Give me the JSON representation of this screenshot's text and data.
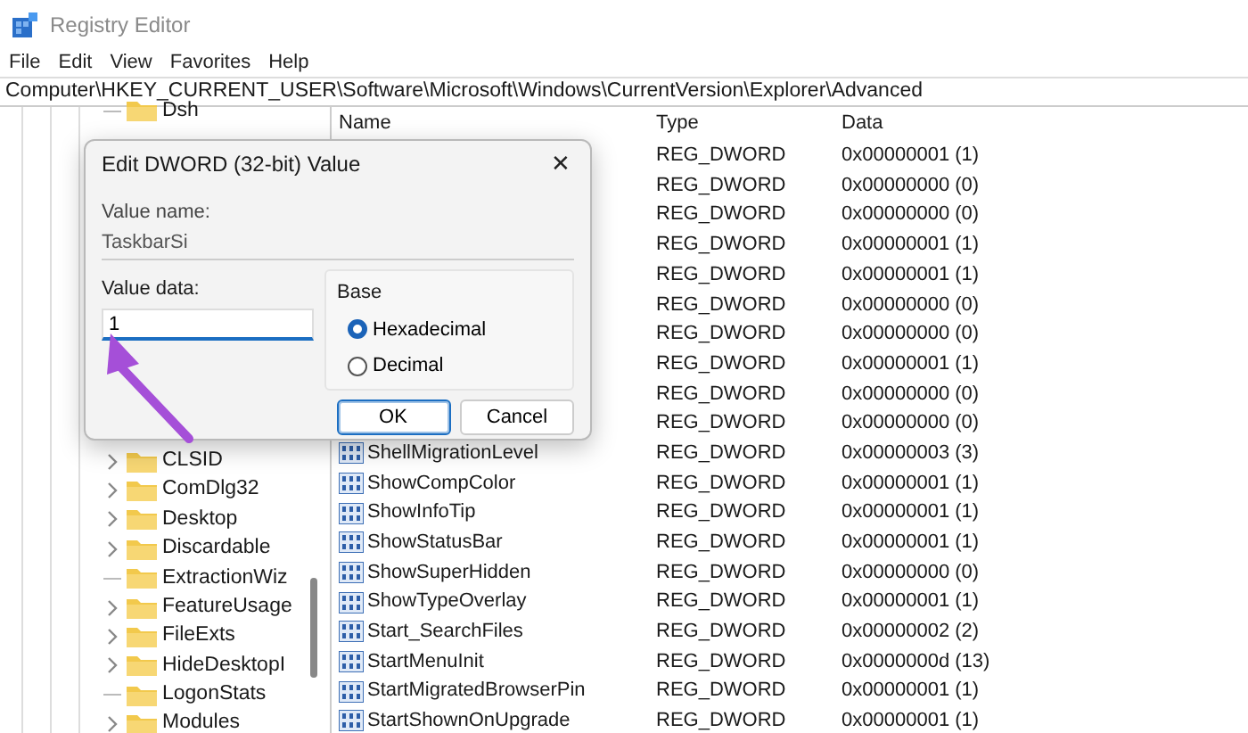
{
  "window": {
    "title": "Registry Editor"
  },
  "menu": [
    "File",
    "Edit",
    "View",
    "Favorites",
    "Help"
  ],
  "address": "Computer\\HKEY_CURRENT_USER\\Software\\Microsoft\\Windows\\CurrentVersion\\Explorer\\Advanced",
  "tree": {
    "items": [
      {
        "label": "Dsh",
        "expandable": false
      },
      {
        "label": "CLSID",
        "expandable": true
      },
      {
        "label": "ComDlg32",
        "expandable": true
      },
      {
        "label": "Desktop",
        "expandable": true
      },
      {
        "label": "Discardable",
        "expandable": true
      },
      {
        "label": "ExtractionWiz",
        "expandable": false
      },
      {
        "label": "FeatureUsage",
        "expandable": true
      },
      {
        "label": "FileExts",
        "expandable": true
      },
      {
        "label": "HideDesktopI",
        "expandable": true
      },
      {
        "label": "LogonStats",
        "expandable": false
      },
      {
        "label": "Modules",
        "expandable": true
      }
    ]
  },
  "list": {
    "columns": [
      "Name",
      "Type",
      "Data"
    ],
    "rows": [
      {
        "type": "REG_DWORD",
        "data": "0x00000001 (1)"
      },
      {
        "type": "REG_DWORD",
        "data": "0x00000000 (0)"
      },
      {
        "type": "REG_DWORD",
        "data": "0x00000000 (0)"
      },
      {
        "type": "REG_DWORD",
        "data": "0x00000001 (1)"
      },
      {
        "type": "REG_DWORD",
        "data": "0x00000001 (1)"
      },
      {
        "type": "REG_DWORD",
        "data": "0x00000000 (0)"
      },
      {
        "type": "REG_DWORD",
        "data": "0x00000000 (0)"
      },
      {
        "type": "REG_DWORD",
        "data": "0x00000001 (1)"
      },
      {
        "type": "REG_DWORD",
        "data": "0x00000000 (0)"
      },
      {
        "type": "REG_DWORD",
        "data": "0x00000000 (0)"
      },
      {
        "name": "ShellMigrationLevel",
        "type": "REG_DWORD",
        "data": "0x00000003 (3)"
      },
      {
        "name": "ShowCompColor",
        "type": "REG_DWORD",
        "data": "0x00000001 (1)"
      },
      {
        "name": "ShowInfoTip",
        "type": "REG_DWORD",
        "data": "0x00000001 (1)"
      },
      {
        "name": "ShowStatusBar",
        "type": "REG_DWORD",
        "data": "0x00000001 (1)"
      },
      {
        "name": "ShowSuperHidden",
        "type": "REG_DWORD",
        "data": "0x00000000 (0)"
      },
      {
        "name": "ShowTypeOverlay",
        "type": "REG_DWORD",
        "data": "0x00000001 (1)"
      },
      {
        "name": "Start_SearchFiles",
        "type": "REG_DWORD",
        "data": "0x00000002 (2)"
      },
      {
        "name": "StartMenuInit",
        "type": "REG_DWORD",
        "data": "0x0000000d (13)"
      },
      {
        "name": "StartMigratedBrowserPin",
        "type": "REG_DWORD",
        "data": "0x00000001 (1)"
      },
      {
        "name": "StartShownOnUpgrade",
        "type": "REG_DWORD",
        "data": "0x00000001 (1)"
      }
    ]
  },
  "dialog": {
    "title": "Edit DWORD (32-bit) Value",
    "close": "✕",
    "value_name_label": "Value name:",
    "value_name": "TaskbarSi",
    "value_data_label": "Value data:",
    "value_data": "1",
    "base_label": "Base",
    "base_options": [
      {
        "label": "Hexadecimal",
        "selected": true
      },
      {
        "label": "Decimal",
        "selected": false
      }
    ],
    "buttons": [
      {
        "label": "OK",
        "default": true
      },
      {
        "label": "Cancel",
        "default": false
      }
    ]
  }
}
